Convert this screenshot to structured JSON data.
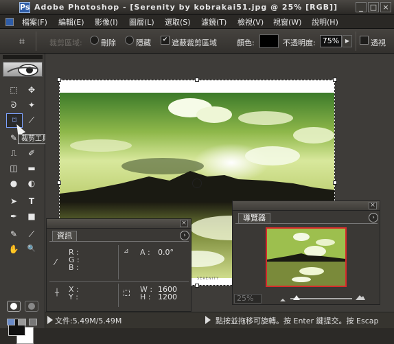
{
  "window": {
    "app_icon": "Ps",
    "title": "Adobe Photoshop - [Serenity by kobrakai51.jpg @ 25% [RGB]]",
    "controls": {
      "minimize": "_",
      "maximize": "□",
      "close": "×"
    }
  },
  "menu": [
    {
      "label": "檔案(F)"
    },
    {
      "label": "編輯(E)"
    },
    {
      "label": "影像(I)"
    },
    {
      "label": "圖層(L)"
    },
    {
      "label": "選取(S)"
    },
    {
      "label": "濾鏡(T)"
    },
    {
      "label": "檢視(V)"
    },
    {
      "label": "視窗(W)"
    },
    {
      "label": "說明(H)"
    }
  ],
  "options_bar": {
    "crop_icon": "crop-icon",
    "crop_area_label": "裁剪區域:",
    "delete_label": "刪除",
    "hide_label": "隱藏",
    "shield_label": "遮蔽裁剪區域",
    "shield_checked": "✔",
    "color_label": "顏色:",
    "color_value": "#000000",
    "opacity_label": "不透明度:",
    "opacity_value": "75%",
    "perspective_label": "透視"
  },
  "tools": {
    "tooltip": "裁剪工具(C)",
    "glyphs": {
      "marquee": "⬚",
      "move": "✥",
      "lasso": "ᘐ",
      "magic_wand": "✦",
      "crop": "⌑",
      "slice": "⟋",
      "healing": "✎",
      "brush": "✏",
      "stamp": "⎍",
      "history_brush": "✐",
      "eraser": "◫",
      "gradient": "▬",
      "blur": "●",
      "dodge": "◐",
      "path_select": "➤",
      "type": "T",
      "pen": "✒",
      "shape": "■",
      "notes": "✎",
      "eyedropper": "⟋",
      "hand": "✋",
      "zoom": "🔍"
    }
  },
  "canvas": {
    "caption": "SERENITY"
  },
  "info_panel": {
    "tab": "資訊",
    "menu_icon": "›",
    "r_label": "R :",
    "g_label": "G :",
    "b_label": "B :",
    "a_label": "A :",
    "a_value": "0.0°",
    "x_label": "X :",
    "y_label": "Y :",
    "w_label": "W :",
    "w_value": "1600",
    "h_label": "H :",
    "h_value": "1200",
    "close": "×"
  },
  "navigator_panel": {
    "tab": "導覽器",
    "menu_icon": "›",
    "zoom_value": "25%",
    "close": "×"
  },
  "status_bar": {
    "doc_info": "文件:5.49M/5.49M",
    "hint": "點按並拖移可旋轉。按 Enter 鍵提交。按 Escap"
  },
  "colors": {
    "accent_crop_highlight": "#7da2ff",
    "navigator_view_box": "#d62b2b"
  }
}
